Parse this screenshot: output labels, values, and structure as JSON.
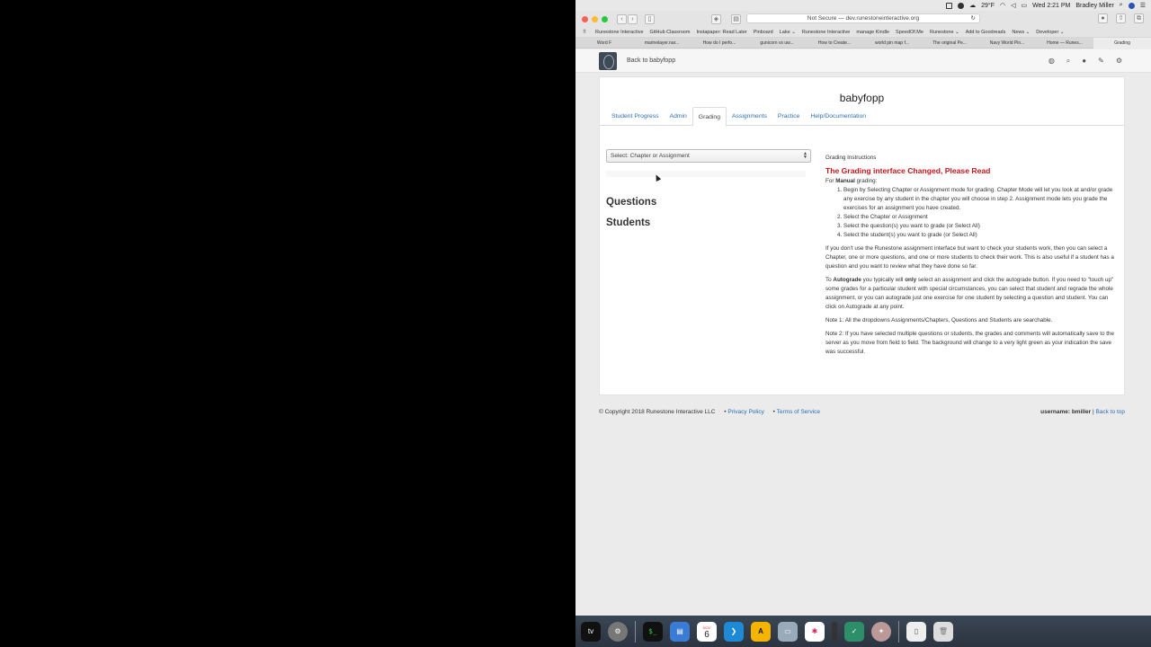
{
  "menubar": {
    "weather": "29°F",
    "clock": "Wed 2:21 PM",
    "user": "Bradley Miller"
  },
  "browser": {
    "address": "Not Secure — dev.runestoneinteractive.org",
    "bookmarks": [
      "Runestone Interactive",
      "GitHub Classroom",
      "Instapaper: Read Later",
      "Pinboard",
      "Lake ⌄",
      "Runestone Interactive",
      "manage Kindle",
      "SpeedOf.Me",
      "Runestone ⌄",
      "Add to Goodreads",
      "News ⌄",
      "Developer ⌄"
    ],
    "tabs": [
      "Word F",
      "marinelayer.nar...",
      "How do I perfo...",
      "gunicorn vs uw...",
      "How to Create...",
      "world pin map f...",
      "The original Pe...",
      "Navy World Pin...",
      "Home — Runes...",
      "Grading"
    ],
    "active_tab_index": 9
  },
  "navbar": {
    "back_label": "Back to babyfopp"
  },
  "course": {
    "title": "babyfopp",
    "tabs": [
      "Student Progress",
      "Admin",
      "Grading",
      "Assignments",
      "Practice",
      "Help/Documentation"
    ],
    "active_tab": "Grading"
  },
  "grading": {
    "select_placeholder": "Select: Chapter or Assignment",
    "questions_heading": "Questions",
    "students_heading": "Students"
  },
  "instructions": {
    "title": "Grading Instructions",
    "warning": "The Grading interface Changed, Please Read",
    "manual_prefix": "For ",
    "manual_bold": "Manual",
    "manual_suffix": " grading:",
    "steps": [
      "Begin by Selecting Chapter or Assignment mode for grading. Chapter Mode will let you look at and/or grade any exercise by any student in the chapter you will choose in step 2. Assignment mode lets you grade the exercises for an assignment you have created.",
      "Select the Chapter or Assignment",
      "Select the question(s) you want to grade (or Select All)",
      "Select the student(s) you want to grade (or Select All)"
    ],
    "para1": "If you don't use the Runestone assignment interface but want to check your students work, then you can select a Chapter, one or more questions, and one or more students to check their work. This is also useful if a student has a question and you want to review what they have done so far.",
    "auto_p1": "To ",
    "auto_bold": "Autograde",
    "auto_p2": " you typically will ",
    "auto_only": "only",
    "auto_p3": " select an assignment and click the autograde button. If you need to \"touch up\" some grades for a particular student with special circumstances, you can select that student and regrade the whole assignment, or you can autograde just one exercise for one student by selecting a question and student. You can click on Autograde at any point.",
    "note1": "Note 1: All the dropdowns Assignments/Chapters, Questions and Students are searchable.",
    "note2": "Note 2: If you have selected multiple questions or students, the grades and comments will automatically save to the server as you move from field to field. The background will change to a very light green as your indication the save was successful."
  },
  "footer": {
    "copyright": "© Copyright 2018 Runestone Interactive LLC",
    "privacy": "Privacy Policy",
    "terms": "Terms of Service",
    "username": "username: bmiller",
    "back_to_top": "Back to top"
  },
  "dock": {
    "calendar_month": "NOV",
    "calendar_day": "6"
  }
}
